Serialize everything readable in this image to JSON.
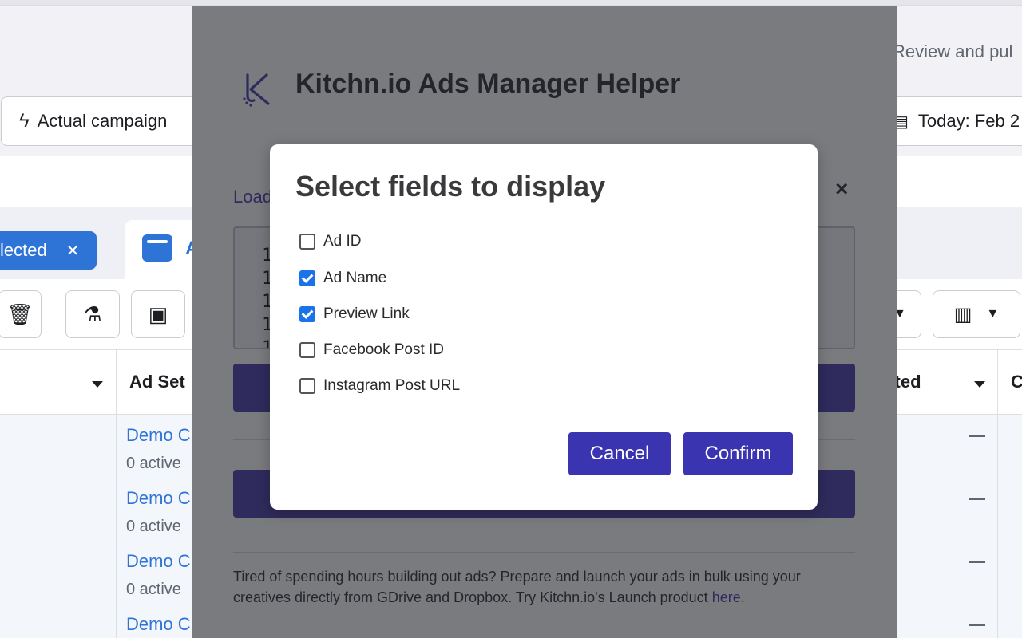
{
  "background": {
    "campaign_filter_label": "Actual campaign",
    "review_label": "Review and pul",
    "date_label": "Today: Feb 2",
    "selected_chip_label": "lected",
    "selected_chip_close": "✕",
    "tab_label_fragment": "A",
    "column_ad_set": "Ad Set",
    "column_started": "rted",
    "column_last": "C",
    "rows": [
      {
        "name": "Demo C",
        "status": "0 active"
      },
      {
        "name": "Demo C",
        "status": "0 active"
      },
      {
        "name": "Demo C",
        "status": "0 active"
      },
      {
        "name": "Demo C",
        "status": ""
      }
    ]
  },
  "panel": {
    "title": "Kitchn.io Ads Manager Helper",
    "load_label": "Load",
    "textarea_lines": [
      "1",
      "1",
      "1",
      "1",
      "1"
    ],
    "close_symbol": "×",
    "footer_text": "Tired of spending hours building out ads? Prepare and launch your ads in bulk using your creatives directly from GDrive and Dropbox. Try Kitchn.io's Launch product ",
    "footer_link": "here",
    "footer_end": "."
  },
  "modal": {
    "title": "Select fields to display",
    "fields": [
      {
        "label": "Ad ID",
        "checked": false
      },
      {
        "label": "Ad Name",
        "checked": true
      },
      {
        "label": "Preview Link",
        "checked": true
      },
      {
        "label": "Facebook Post ID",
        "checked": false
      },
      {
        "label": "Instagram Post URL",
        "checked": false
      }
    ],
    "cancel_label": "Cancel",
    "confirm_label": "Confirm"
  },
  "colors": {
    "brand_purple": "#3b2ea3",
    "button_purple": "#3b34b0",
    "checkbox_blue": "#1a73e8",
    "fb_blue": "#2d74d6"
  }
}
